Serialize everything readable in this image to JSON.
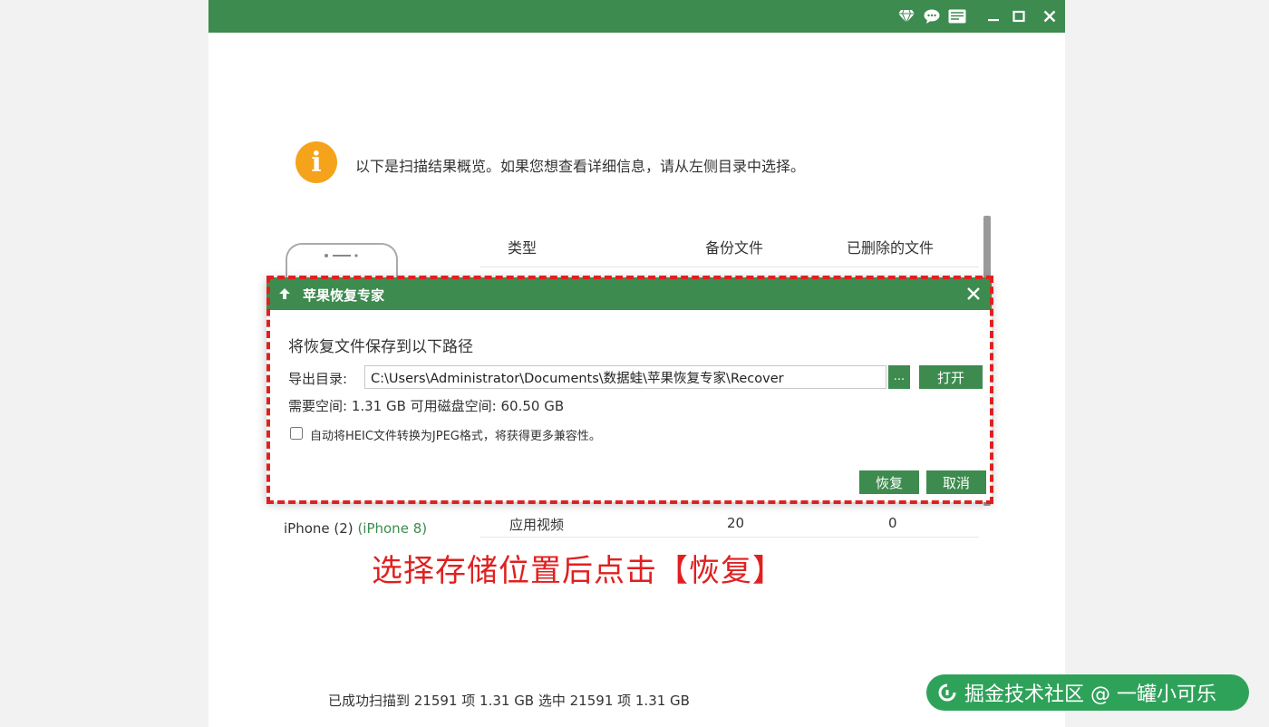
{
  "colors": {
    "brand_green": "#3d8b4f",
    "info_orange": "#f5a31a",
    "highlight_red": "#e02020"
  },
  "titlebar": {
    "icons": [
      "diamond-icon",
      "chat-icon",
      "message-icon",
      "minimize-icon",
      "maximize-icon",
      "close-icon"
    ]
  },
  "overview": {
    "info_text": "以下是扫描结果概览。如果您想查看详细信息，请从左侧目录中选择。",
    "columns": [
      "类型",
      "备份文件",
      "已删除的文件"
    ],
    "device_name": "iPhone (2)",
    "device_model": "(iPhone 8)",
    "rows": [
      {
        "type": "应用视频",
        "backup": "20",
        "deleted": "0"
      }
    ]
  },
  "dialog": {
    "title": "苹果恢复专家",
    "heading": "将恢复文件保存到以下路径",
    "path_label": "导出目录:",
    "path_value": "C:\\Users\\Administrator\\Documents\\数据蛙\\苹果恢复专家\\Recover",
    "browse_label": "...",
    "open_label": "打开",
    "space_info": "需要空间: 1.31 GB  可用磁盘空间: 60.50 GB",
    "heic_label": "自动将HEIC文件转换为JPEG格式，将获得更多兼容性。",
    "heic_checked": false,
    "recover_label": "恢复",
    "cancel_label": "取消"
  },
  "caption": "选择存储位置后点击【恢复】",
  "status_bar": "已成功扫描到 21591 项 1.31 GB  选中 21591 项 1.31 GB",
  "watermark": "掘金技术社区 @ 一罐小可乐"
}
